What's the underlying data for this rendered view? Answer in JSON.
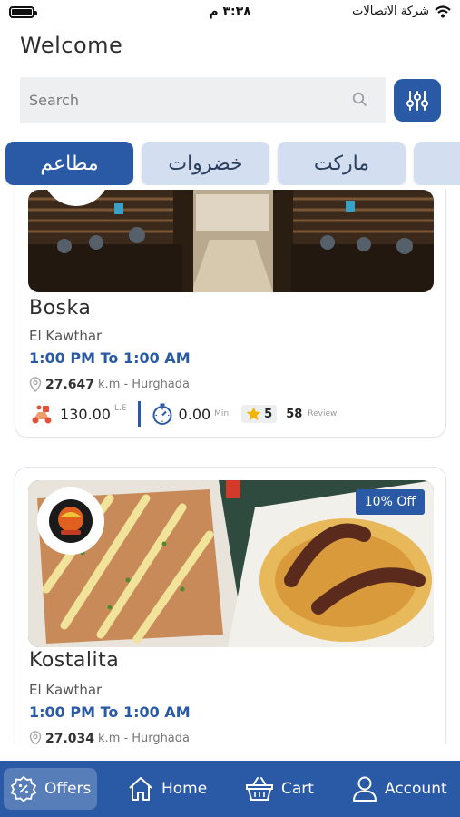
{
  "status": {
    "time": "٣:٣٨ م",
    "carrier": "شركة الاتصالات"
  },
  "header": {
    "title": "Welcome"
  },
  "search": {
    "placeholder": "Search"
  },
  "categories": [
    {
      "label": "مطاعم",
      "active": true
    },
    {
      "label": "خضروات",
      "active": false
    },
    {
      "label": "ماركت",
      "active": false
    }
  ],
  "restaurants": [
    {
      "name": "Boska",
      "area": "El Kawthar",
      "hours": "1:00 PM  To 1:00 AM",
      "distance": "27.647",
      "distance_unit": "k.m -",
      "city": "Hurghada",
      "delivery_fee": "130.00",
      "currency": "L.E",
      "time": "0.00",
      "time_unit": "Min",
      "rating": "5",
      "reviews": "58",
      "reviews_label": "Review"
    },
    {
      "name": "Kostalita",
      "area": "El Kawthar",
      "hours": "1:00 PM  To 1:00 AM",
      "distance": "27.034",
      "distance_unit": "k.m -",
      "city": "Hurghada",
      "offer": "10% Off"
    }
  ],
  "nav": {
    "offers": "Offers",
    "home": "Home",
    "cart": "Cart",
    "account": "Account"
  },
  "colors": {
    "primary": "#2a5aa6",
    "tab_inactive": "#d3def0",
    "search_bg": "#eeeff1"
  }
}
